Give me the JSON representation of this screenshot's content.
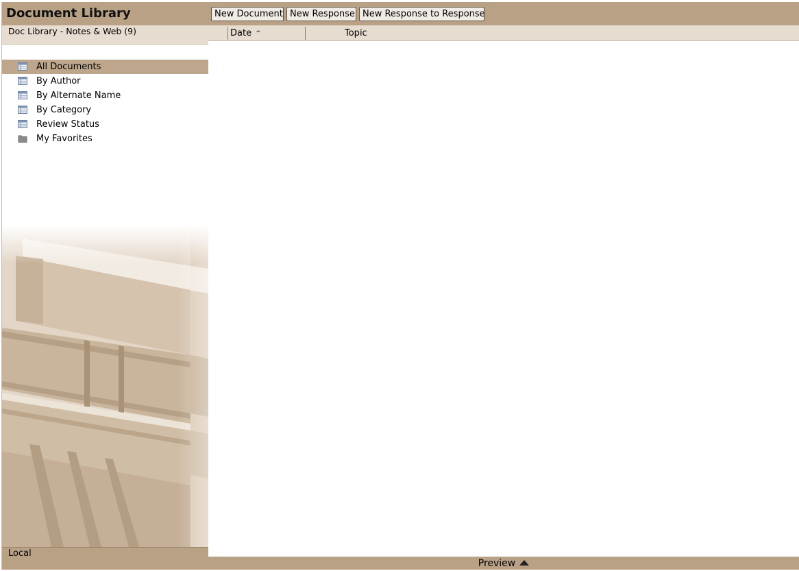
{
  "app": {
    "title": "Document Library",
    "database": "Doc Library - Notes & Web (9)",
    "location": "Local"
  },
  "sidebar": {
    "items": [
      {
        "label": "All Documents",
        "icon": "view-icon",
        "selected": true
      },
      {
        "label": "By Author",
        "icon": "view-icon"
      },
      {
        "label": "By Alternate Name",
        "icon": "view-icon"
      },
      {
        "label": "By Category",
        "icon": "view-icon"
      },
      {
        "label": "Review Status",
        "icon": "view-icon"
      },
      {
        "label": "My Favorites",
        "icon": "folder-icon"
      }
    ]
  },
  "toolbar": {
    "new_document": "New Document",
    "new_response": "New Response",
    "new_response_to_response": "New Response to Response"
  },
  "columns": {
    "date": "Date",
    "topic": "Topic",
    "date_sort": "ascending"
  },
  "preview": {
    "label": "Preview"
  },
  "colors": {
    "accent": "#b9a186",
    "selected": "#bda68c",
    "light": "#e6dccf"
  }
}
